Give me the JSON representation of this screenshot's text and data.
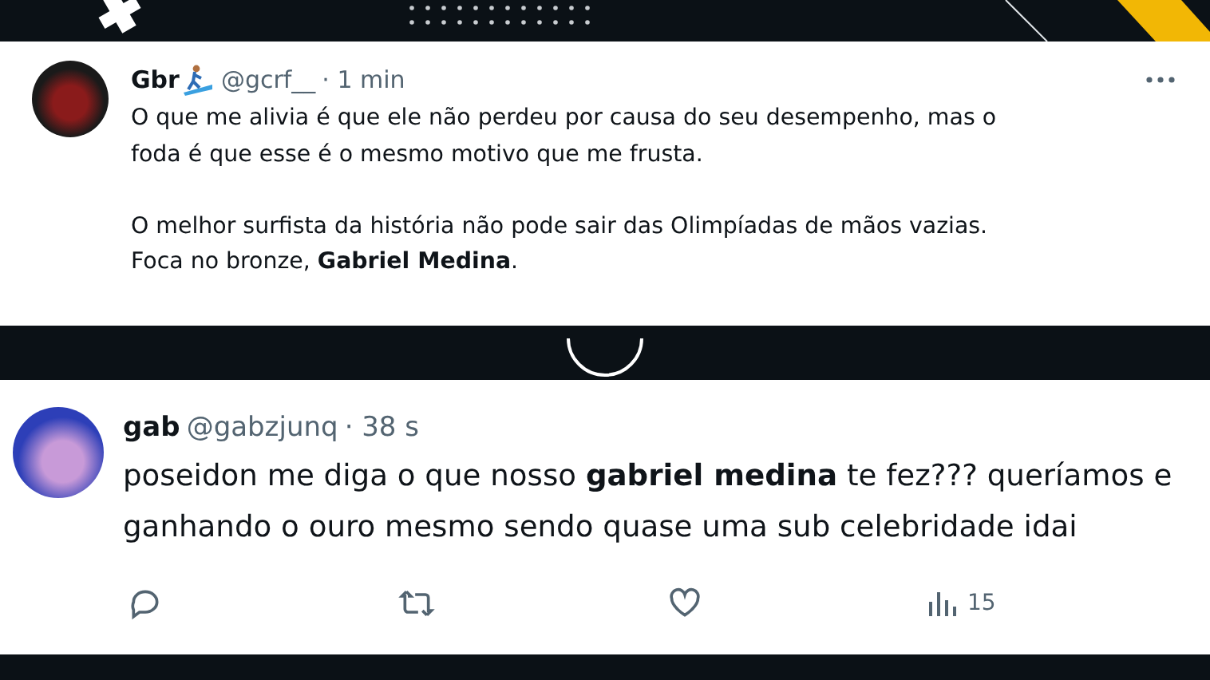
{
  "tweets": [
    {
      "kind": "compact",
      "name": "Gbr",
      "name_emoji": true,
      "handle": "@gcrf__",
      "time": "· 1 min",
      "more_menu": true,
      "paragraphs": [
        [
          "O que me alivia é que ele não perdeu por causa do seu desempenho, mas o",
          "foda é que esse é o mesmo motivo que me frusta."
        ],
        [
          "O melhor surfista da história não pode sair das Olimpíadas de mãos vazias.",
          "Foca no bronze, **Gabriel Medina**."
        ]
      ]
    },
    {
      "kind": "large",
      "name": "gab",
      "name_emoji": false,
      "handle": "@gabzjunq",
      "time": "· 38 s",
      "more_menu": false,
      "paragraphs": [
        [
          "poseidon me diga o que nosso **gabriel medina** te fez??? queríamos e",
          "ganhando o ouro mesmo sendo quase uma sub celebridade idai"
        ]
      ],
      "views": "15"
    }
  ]
}
